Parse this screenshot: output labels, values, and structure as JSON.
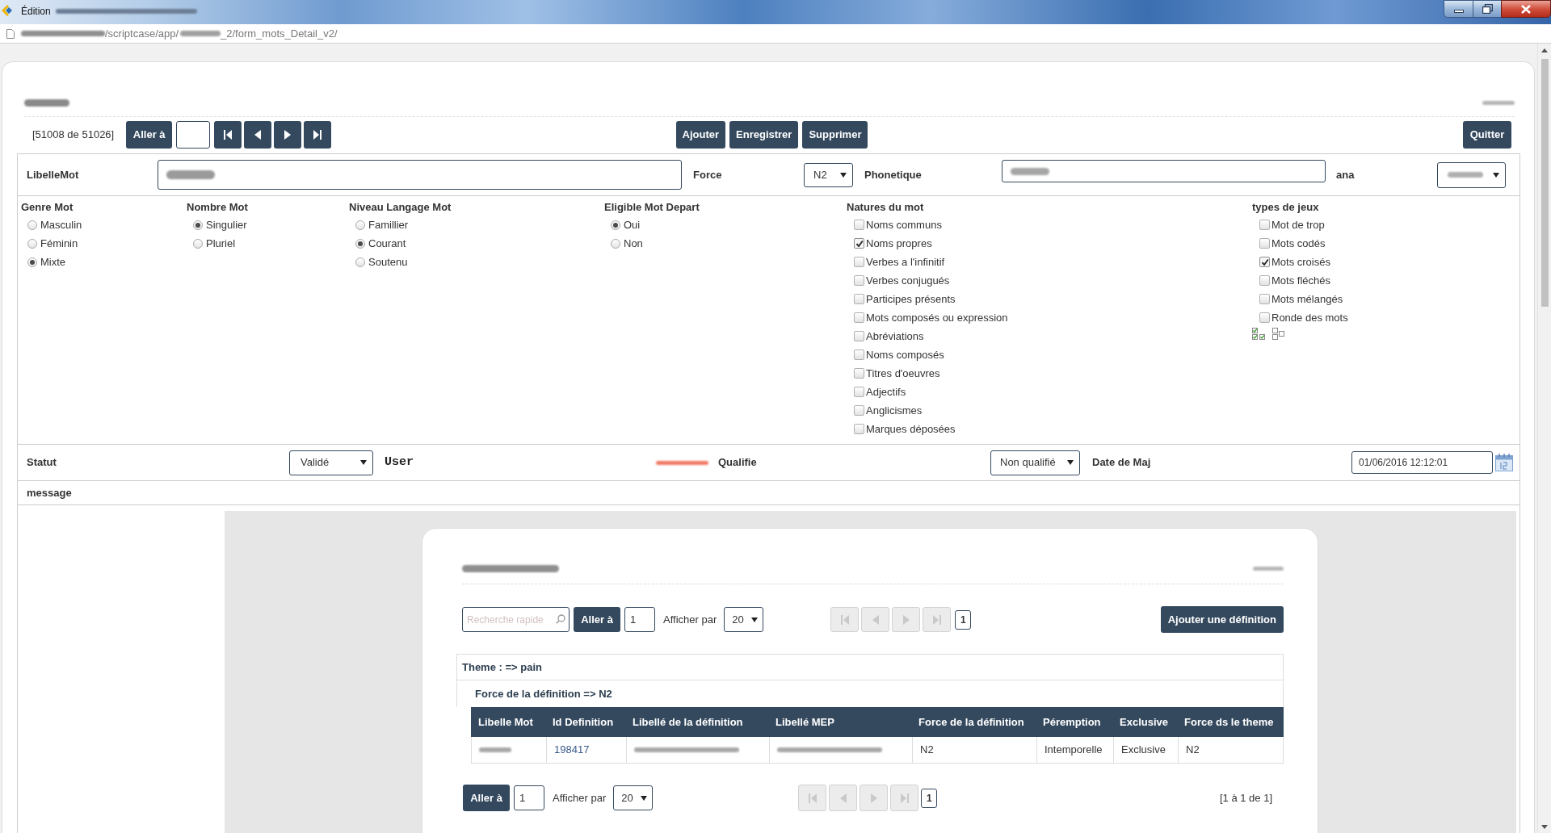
{
  "window": {
    "title": "Édition"
  },
  "address_bar": {
    "url_parts": [
      "/scriptcase/app/",
      "_2/form_mots_Detail_v2/"
    ]
  },
  "form": {
    "toolbar": {
      "record_counter": "[51008 de 51026]",
      "goto_button": "Aller à",
      "nav_disabled": false,
      "actions": [
        "Ajouter",
        "Enregistrer",
        "Supprimer"
      ],
      "quit_button": "Quitter"
    },
    "fields_row": {
      "libellemot_label": "LibelleMot",
      "force_label": "Force",
      "force_value": "N2",
      "phonetique_label": "Phonetique",
      "ana_label": "ana"
    },
    "radio_groups": [
      {
        "title": "Genre Mot",
        "options": [
          {
            "label": "Masculin",
            "selected": false
          },
          {
            "label": "Féminin",
            "selected": false
          },
          {
            "label": "Mixte",
            "selected": true
          }
        ]
      },
      {
        "title": "Nombre Mot",
        "options": [
          {
            "label": "Singulier",
            "selected": true
          },
          {
            "label": "Pluriel",
            "selected": false
          }
        ]
      },
      {
        "title": "Niveau Langage Mot",
        "options": [
          {
            "label": "Famillier",
            "selected": false
          },
          {
            "label": "Courant",
            "selected": true
          },
          {
            "label": "Soutenu",
            "selected": false
          }
        ]
      },
      {
        "title": "Eligible Mot Depart",
        "options": [
          {
            "label": "Oui",
            "selected": true
          },
          {
            "label": "Non",
            "selected": false
          }
        ]
      }
    ],
    "checkbox_groups": [
      {
        "title": "Natures du mot",
        "options": [
          {
            "label": "Noms communs",
            "checked": false
          },
          {
            "label": "Noms propres",
            "checked": true
          },
          {
            "label": "Verbes a l'infinitif",
            "checked": false
          },
          {
            "label": "Verbes conjugués",
            "checked": false
          },
          {
            "label": "Participes présents",
            "checked": false
          },
          {
            "label": "Mots composés ou expression",
            "checked": false
          },
          {
            "label": "Abréviations",
            "checked": false
          },
          {
            "label": "Noms composés",
            "checked": false
          },
          {
            "label": "Titres d'oeuvres",
            "checked": false
          },
          {
            "label": "Adjectifs",
            "checked": false
          },
          {
            "label": "Anglicismes",
            "checked": false
          },
          {
            "label": "Marques déposées",
            "checked": false
          }
        ]
      },
      {
        "title": "types de jeux",
        "select_all_tools": true,
        "options": [
          {
            "label": "Mot de trop",
            "checked": false
          },
          {
            "label": "Mots codés",
            "checked": false
          },
          {
            "label": "Mots croisés",
            "checked": true
          },
          {
            "label": "Mots fléchés",
            "checked": false
          },
          {
            "label": "Mots mélangés",
            "checked": false
          },
          {
            "label": "Ronde des mots",
            "checked": false
          }
        ]
      }
    ],
    "status_row": {
      "statut_label": "Statut",
      "statut_value": "Validé",
      "user_label": "User",
      "qualifie_label": "Qualifie",
      "qualifie_value": "Non qualifié",
      "date_label": "Date de Maj",
      "date_value": "01/06/2016 12:12:01"
    },
    "message_label": "message"
  },
  "definitions": {
    "toolbar": {
      "search_placeholder": "Recherche rapide",
      "goto_button": "Aller à",
      "goto_value": "1",
      "per_page_label": "Afficher par",
      "per_page_value": "20",
      "nav_disabled": true,
      "page": "1",
      "add_button": "Ajouter une définition"
    },
    "group_theme": "Theme : => pain",
    "group_force": "Force de la définition => N2",
    "table": {
      "columns": [
        "Libelle Mot",
        "Id Definition",
        "Libellé de la définition",
        "Libellé MEP",
        "Force de la définition",
        "Péremption",
        "Exclusive",
        "Force ds le theme"
      ],
      "rows": [
        {
          "cells": [
            {
              "kind": "blurred"
            },
            {
              "kind": "link",
              "text": "198417"
            },
            {
              "kind": "blurred"
            },
            {
              "kind": "blurred"
            },
            {
              "kind": "text",
              "text": "N2"
            },
            {
              "kind": "text",
              "text": "Intemporelle"
            },
            {
              "kind": "text",
              "text": "Exclusive"
            },
            {
              "kind": "text",
              "text": "N2"
            }
          ]
        }
      ]
    },
    "bottom_bar": {
      "goto_button": "Aller à",
      "goto_value": "1",
      "per_page_label": "Afficher par",
      "per_page_value": "20",
      "nav_disabled": true,
      "page": "1",
      "summary": "[1 à 1 de 1]"
    }
  }
}
